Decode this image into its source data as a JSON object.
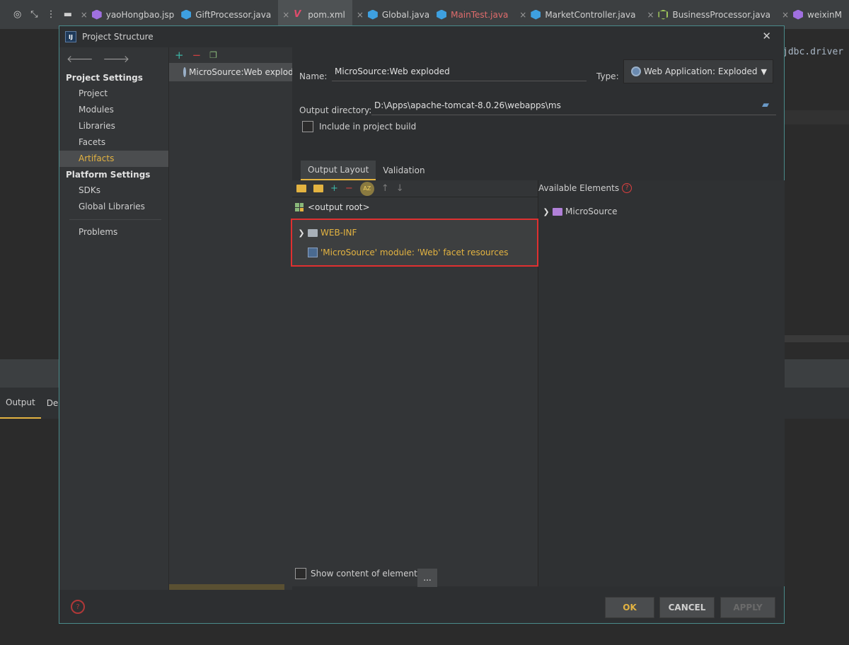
{
  "ide": {
    "tabs": [
      {
        "label": "yaoHongbao.jsp",
        "icon": "jsp-file-icon"
      },
      {
        "label": "GiftProcessor.java",
        "icon": "java-class-icon"
      },
      {
        "label": "pom.xml",
        "icon": "maven-icon"
      },
      {
        "label": "Global.java",
        "icon": "java-class-icon"
      },
      {
        "label": "MainTest.java",
        "icon": "java-class-icon"
      },
      {
        "label": "MarketController.java",
        "icon": "java-class-icon"
      },
      {
        "label": "BusinessProcessor.java",
        "icon": "java-class-icon"
      },
      {
        "label": "weixinM",
        "icon": "jsp-file-icon"
      }
    ],
    "code_peek": "jdbc.driver",
    "bottom_tabs": [
      "Output",
      "Depl"
    ]
  },
  "dialog": {
    "title": "Project Structure",
    "logo_text": "IJ",
    "sidebar": {
      "project_settings_header": "Project Settings",
      "project_items": [
        "Project",
        "Modules",
        "Libraries",
        "Facets",
        "Artifacts"
      ],
      "platform_settings_header": "Platform Settings",
      "platform_items": [
        "SDKs",
        "Global Libraries"
      ],
      "problems": "Problems",
      "selected": "Artifacts"
    },
    "artifact_list": {
      "items": [
        "MicroSource:Web exploded"
      ]
    },
    "form": {
      "name_label": "Name:",
      "name_value": "MicroSource:Web exploded",
      "type_label": "Type:",
      "type_value": "Web Application: Exploded",
      "output_dir_label": "Output directory:",
      "output_dir_value": "D:\\Apps\\apache-tomcat-8.0.26\\webapps\\ms",
      "include_label": "Include in project build",
      "include_checked": false
    },
    "tabs": [
      "Output Layout",
      "Validation"
    ],
    "active_tab": "Output Layout",
    "output_tree": {
      "root": "<output root>",
      "children": [
        "WEB-INF",
        "'MicroSource' module: 'Web' facet resources"
      ]
    },
    "available": {
      "header": "Available Elements",
      "items": [
        "MicroSource"
      ]
    },
    "show_content_label": "Show content of elements",
    "dots_label": "...",
    "buttons": {
      "ok": "OK",
      "cancel": "CANCEL",
      "apply": "APPLY"
    },
    "colors": {
      "accent": "#e3b341",
      "highlight_border": "#e03030",
      "dialog_border": "#4a8a8a"
    }
  }
}
